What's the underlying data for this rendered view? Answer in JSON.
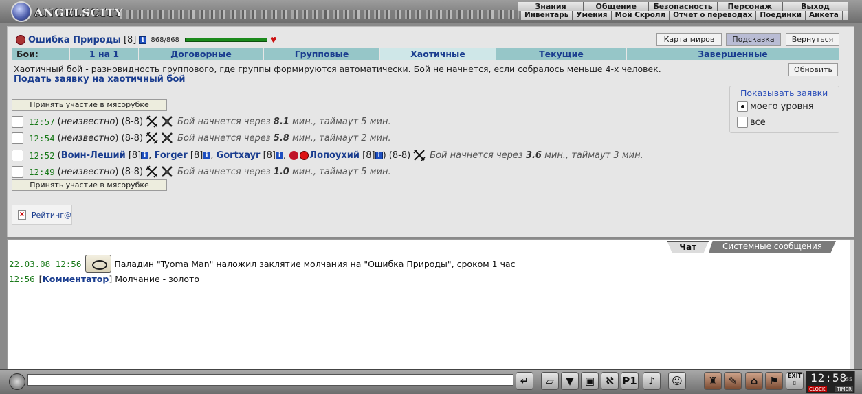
{
  "app": {
    "logo_text": "ANGELSCITY"
  },
  "menu_primary": [
    "Знания",
    "Общение",
    "Безопасность",
    "Персонаж",
    "Выход"
  ],
  "menu_secondary": [
    "Инвентарь",
    "Умения",
    "Мой Скролл",
    "Отчет о переводах",
    "Поединки",
    "Анкета"
  ],
  "character": {
    "name": "Ошибка Природы",
    "level": "[8]",
    "info_glyph": "i",
    "hp": "868/868",
    "hp_fraction": 1.0
  },
  "buttons": {
    "world_map": "Карта миров",
    "hint": "Подсказка",
    "back": "Вернуться",
    "refresh": "Обновить",
    "join": "Принять участие в мясорубке"
  },
  "tabs": [
    "Бои:",
    "1 на 1",
    "Договорные",
    "Групповые",
    "Хаотичные",
    "Текущие",
    "Завершенные"
  ],
  "description": "Хаотичный бой - разновидность группового, где группы формируются автоматически. Бой не начнется, если собралось меньше 4-х человек.",
  "submit_link": "Подать заявку на хаотичный бой",
  "filter": {
    "legend": "Показывать заявки",
    "options": [
      "моего уровня",
      "все"
    ],
    "selected": 0
  },
  "fights": [
    {
      "time": "12:57",
      "who": "неизвестно",
      "range": "(8-8)",
      "note_pre": "Бой начнется через",
      "minutes": "8.1",
      "note_post": "мин., таймаут 5 мин."
    },
    {
      "time": "12:54",
      "who": "неизвестно",
      "range": "(8-8)",
      "note_pre": "Бой начнется через",
      "minutes": "5.8",
      "note_post": "мин., таймаут 2 мин."
    },
    {
      "time": "12:52",
      "players": [
        {
          "name": "Воин-Леший",
          "level": "[8]"
        },
        {
          "name": "Forger",
          "level": "[8]"
        },
        {
          "name": "Gortxayr",
          "level": "[8]"
        },
        {
          "name": "Лопоухий",
          "level": "[8]"
        }
      ],
      "range": "(8-8)",
      "note_pre": "Бой начнется через",
      "minutes": "3.6",
      "note_post": "мин., таймаут 3 мин."
    },
    {
      "time": "12:49",
      "who": "неизвестно",
      "range": "(8-8)",
      "note_pre": "Бой начнется через",
      "minutes": "1.0",
      "note_post": "мин., таймаут 5 мин."
    }
  ],
  "rating": {
    "label": "Рейтинг@"
  },
  "chat": {
    "tabs": [
      "Чат",
      "Системные сообщения"
    ],
    "messages": [
      {
        "timestamp": "22.03.08 12:56",
        "text": "Паладин \"Tyoma Man\" наложил заклятие молчания на \"Ошибка Природы\", сроком 1 час"
      },
      {
        "timestamp": "12:56",
        "author": "Комментатор",
        "text": "Молчание - золото"
      }
    ]
  },
  "clock": {
    "time": "12:58",
    "seconds_label": "SS",
    "clock_label": "CLOCK",
    "timer_label": "TIMER"
  },
  "exit_label": "EXIT",
  "toolbar_icons": [
    "enter-icon",
    "eraser-icon",
    "filter-icon",
    "computer-icon",
    "runner-icon",
    "p1-icon",
    "music-icon",
    "smiley-icon",
    "bottle-icon",
    "scroll-icon",
    "lock-icon",
    "flag-icon",
    "exit-icon"
  ]
}
